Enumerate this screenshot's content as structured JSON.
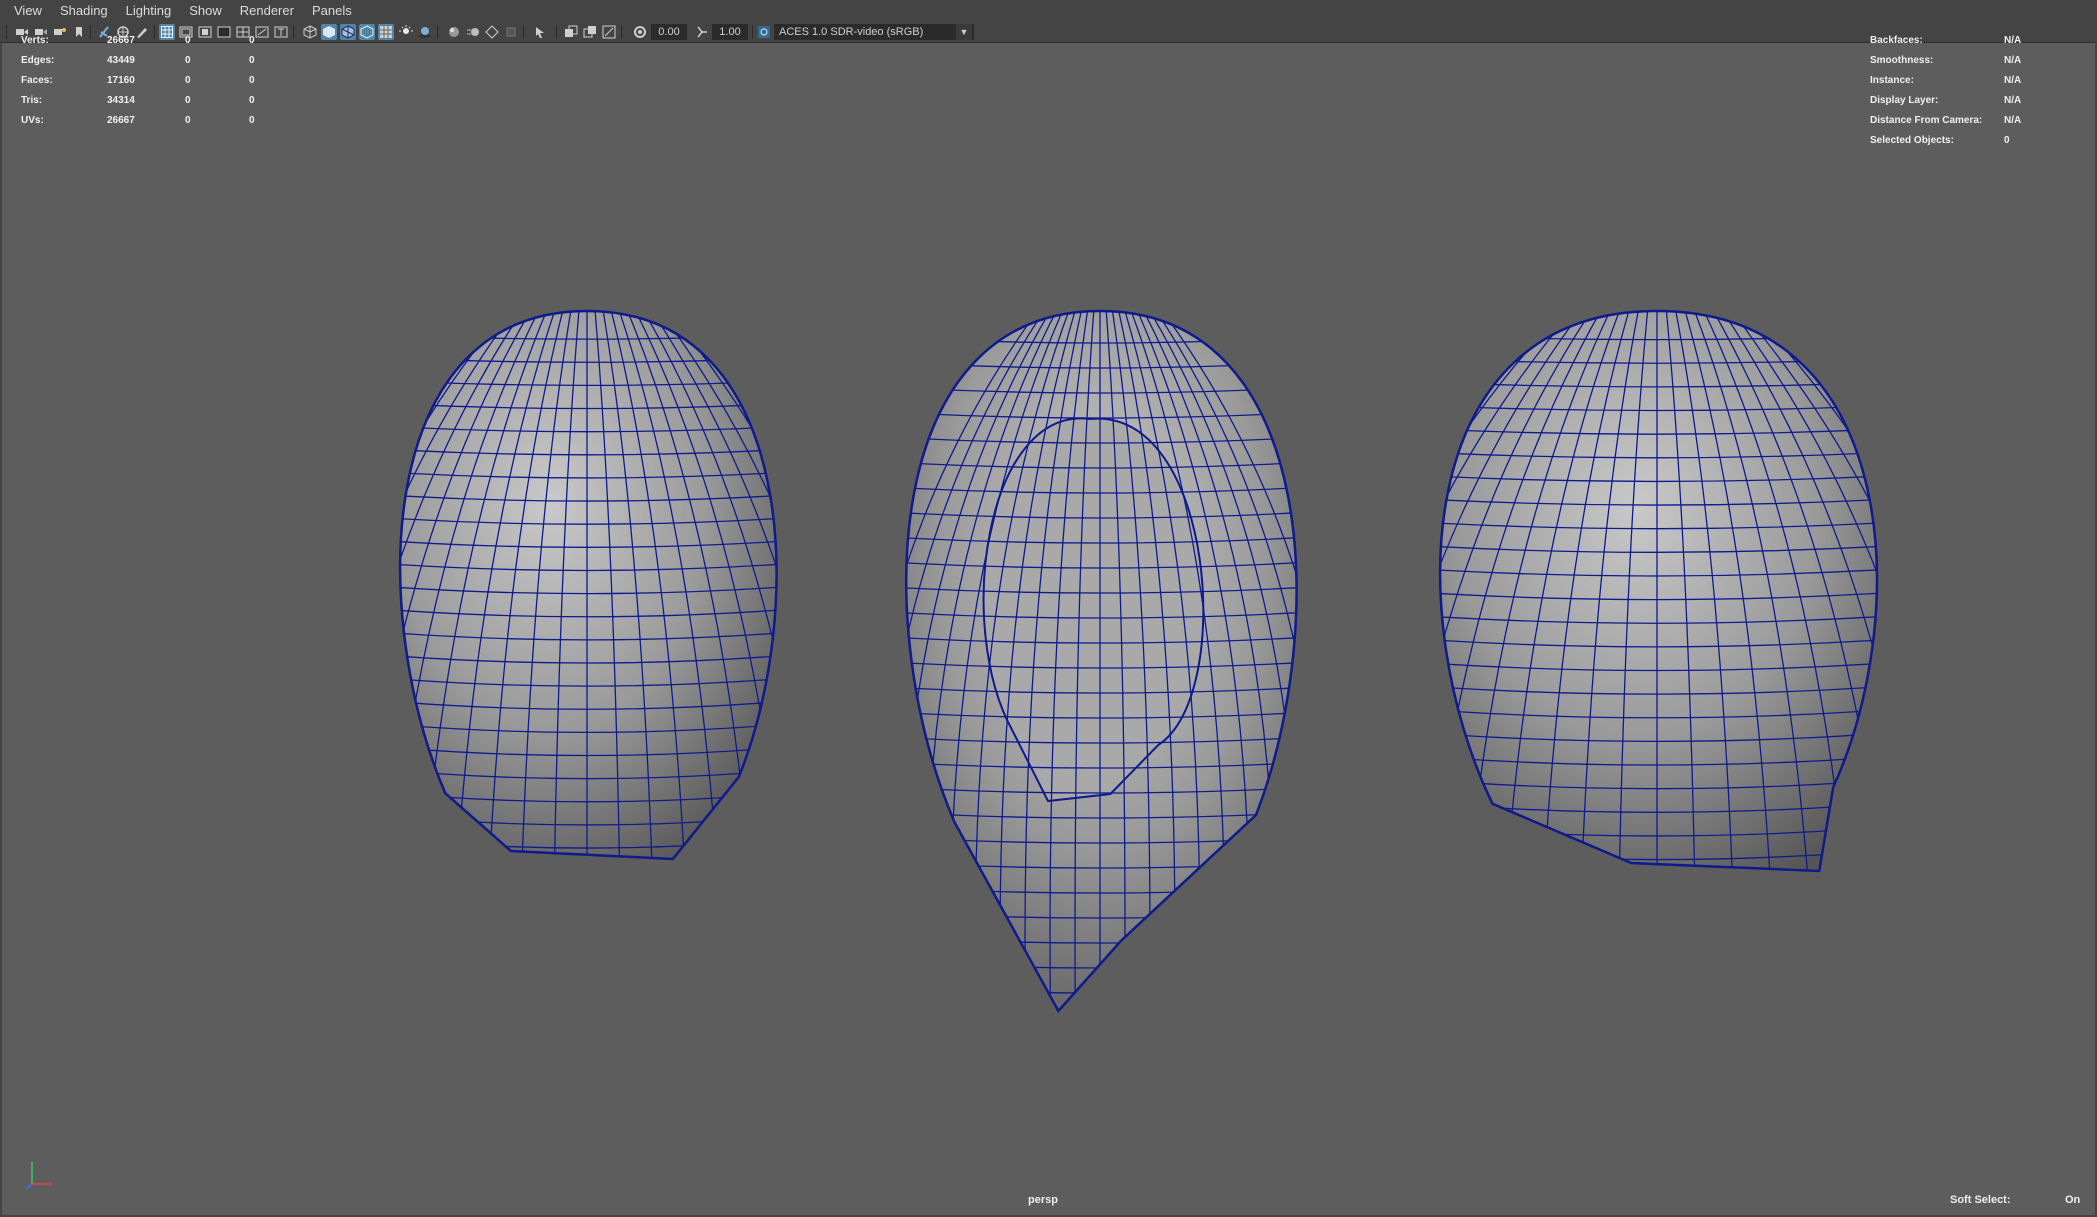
{
  "menu": [
    "View",
    "Shading",
    "Lighting",
    "Show",
    "Renderer",
    "Panels"
  ],
  "toolbar": {
    "value1": "0.00",
    "value2": "1.00",
    "color_transform": "ACES 1.0 SDR-video (sRGB)"
  },
  "hud_left": {
    "rows": [
      {
        "label": "Verts:",
        "v1": "26667",
        "v2": "0",
        "v3": "0"
      },
      {
        "label": "Edges:",
        "v1": "43449",
        "v2": "0",
        "v3": "0"
      },
      {
        "label": "Faces:",
        "v1": "17160",
        "v2": "0",
        "v3": "0"
      },
      {
        "label": "Tris:",
        "v1": "34314",
        "v2": "0",
        "v3": "0"
      },
      {
        "label": "UVs:",
        "v1": "26667",
        "v2": "0",
        "v3": "0"
      }
    ]
  },
  "hud_right": {
    "rows": [
      {
        "label": "Backfaces:",
        "value": "N/A"
      },
      {
        "label": "Smoothness:",
        "value": "N/A"
      },
      {
        "label": "Instance:",
        "value": "N/A"
      },
      {
        "label": "Display Layer:",
        "value": "N/A"
      },
      {
        "label": "Distance From Camera:",
        "value": "N/A"
      },
      {
        "label": "Selected Objects:",
        "value": "0"
      }
    ]
  },
  "camera": "persp",
  "soft_select": {
    "label": "Soft Select:",
    "value": "On"
  },
  "colors": {
    "wire": "#0f1a8c",
    "surface": "#8a8a8a",
    "viewport_bg": "#5d5d5d",
    "highlight": "#5285a6"
  }
}
